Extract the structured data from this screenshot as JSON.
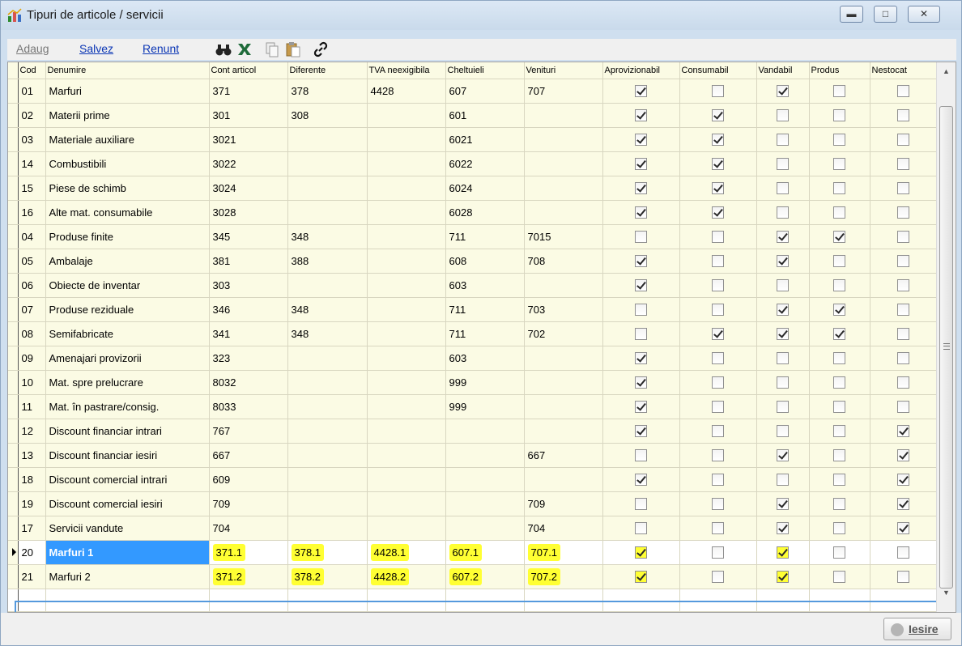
{
  "window": {
    "title": "Tipuri de articole / servicii",
    "icons": {
      "app": "chart-app-icon",
      "minimize": "minimize-icon",
      "restore": "restore-icon",
      "close": "close-icon"
    }
  },
  "toolbar": {
    "add_label": "Adaug",
    "save_label": "Salvez",
    "cancel_label": "Renunt",
    "icons": [
      "binoculars-icon",
      "excel-icon",
      "copy-icon",
      "paste-icon",
      "link-icon"
    ]
  },
  "grid": {
    "columns": [
      "Cod",
      "Denumire",
      "Cont articol",
      "Diferente",
      "TVA neexigibila",
      "Cheltuieli",
      "Venituri",
      "Aprovizionabil",
      "Consumabil",
      "Vandabil",
      "Produs",
      "Nestocat"
    ],
    "rows": [
      {
        "cod": "01",
        "denumire": "Marfuri",
        "cont": "371",
        "dif": "378",
        "tva": "4428",
        "chelt": "607",
        "ven": "707",
        "flags": [
          true,
          false,
          true,
          false,
          false
        ]
      },
      {
        "cod": "02",
        "denumire": "Materii prime",
        "cont": "301",
        "dif": "308",
        "tva": "",
        "chelt": "601",
        "ven": "",
        "flags": [
          true,
          true,
          false,
          false,
          false
        ]
      },
      {
        "cod": "03",
        "denumire": "Materiale auxiliare",
        "cont": "3021",
        "dif": "",
        "tva": "",
        "chelt": "6021",
        "ven": "",
        "flags": [
          true,
          true,
          false,
          false,
          false
        ]
      },
      {
        "cod": "14",
        "denumire": "Combustibili",
        "cont": "3022",
        "dif": "",
        "tva": "",
        "chelt": "6022",
        "ven": "",
        "flags": [
          true,
          true,
          false,
          false,
          false
        ]
      },
      {
        "cod": "15",
        "denumire": "Piese de schimb",
        "cont": "3024",
        "dif": "",
        "tva": "",
        "chelt": "6024",
        "ven": "",
        "flags": [
          true,
          true,
          false,
          false,
          false
        ]
      },
      {
        "cod": "16",
        "denumire": "Alte mat. consumabile",
        "cont": "3028",
        "dif": "",
        "tva": "",
        "chelt": "6028",
        "ven": "",
        "flags": [
          true,
          true,
          false,
          false,
          false
        ]
      },
      {
        "cod": "04",
        "denumire": "Produse finite",
        "cont": "345",
        "dif": "348",
        "tva": "",
        "chelt": "711",
        "ven": "7015",
        "flags": [
          false,
          false,
          true,
          true,
          false
        ]
      },
      {
        "cod": "05",
        "denumire": "Ambalaje",
        "cont": "381",
        "dif": "388",
        "tva": "",
        "chelt": "608",
        "ven": "708",
        "flags": [
          true,
          false,
          true,
          false,
          false
        ]
      },
      {
        "cod": "06",
        "denumire": "Obiecte de inventar",
        "cont": "303",
        "dif": "",
        "tva": "",
        "chelt": "603",
        "ven": "",
        "flags": [
          true,
          false,
          false,
          false,
          false
        ]
      },
      {
        "cod": "07",
        "denumire": "Produse reziduale",
        "cont": "346",
        "dif": "348",
        "tva": "",
        "chelt": "711",
        "ven": "703",
        "flags": [
          false,
          false,
          true,
          true,
          false
        ]
      },
      {
        "cod": "08",
        "denumire": "Semifabricate",
        "cont": "341",
        "dif": "348",
        "tva": "",
        "chelt": "711",
        "ven": "702",
        "flags": [
          false,
          true,
          true,
          true,
          false
        ]
      },
      {
        "cod": "09",
        "denumire": "Amenajari provizorii",
        "cont": "323",
        "dif": "",
        "tva": "",
        "chelt": "603",
        "ven": "",
        "flags": [
          true,
          false,
          false,
          false,
          false
        ]
      },
      {
        "cod": "10",
        "denumire": "Mat. spre prelucrare",
        "cont": "8032",
        "dif": "",
        "tva": "",
        "chelt": "999",
        "ven": "",
        "flags": [
          true,
          false,
          false,
          false,
          false
        ]
      },
      {
        "cod": "11",
        "denumire": "Mat. în pastrare/consig.",
        "cont": "8033",
        "dif": "",
        "tva": "",
        "chelt": "999",
        "ven": "",
        "flags": [
          true,
          false,
          false,
          false,
          false
        ]
      },
      {
        "cod": "12",
        "denumire": "Discount financiar intrari",
        "cont": "767",
        "dif": "",
        "tva": "",
        "chelt": "",
        "ven": "",
        "flags": [
          true,
          false,
          false,
          false,
          true
        ]
      },
      {
        "cod": "13",
        "denumire": "Discount financiar iesiri",
        "cont": "667",
        "dif": "",
        "tva": "",
        "chelt": "",
        "ven": "667",
        "flags": [
          false,
          false,
          true,
          false,
          true
        ]
      },
      {
        "cod": "18",
        "denumire": "Discount comercial intrari",
        "cont": "609",
        "dif": "",
        "tva": "",
        "chelt": "",
        "ven": "",
        "flags": [
          true,
          false,
          false,
          false,
          true
        ]
      },
      {
        "cod": "19",
        "denumire": "Discount comercial iesiri",
        "cont": "709",
        "dif": "",
        "tva": "",
        "chelt": "",
        "ven": "709",
        "flags": [
          false,
          false,
          true,
          false,
          true
        ]
      },
      {
        "cod": "17",
        "denumire": "Servicii vandute",
        "cont": "704",
        "dif": "",
        "tva": "",
        "chelt": "",
        "ven": "704",
        "flags": [
          false,
          false,
          true,
          false,
          true
        ]
      },
      {
        "cod": "20",
        "denumire": "Marfuri 1",
        "cont": "371.1",
        "dif": "378.1",
        "tva": "4428.1",
        "chelt": "607.1",
        "ven": "707.1",
        "flags": [
          true,
          false,
          true,
          false,
          false
        ],
        "selected": true,
        "highlight": true
      },
      {
        "cod": "21",
        "denumire": "Marfuri 2",
        "cont": "371.2",
        "dif": "378.2",
        "tva": "4428.2",
        "chelt": "607.2",
        "ven": "707.2",
        "flags": [
          true,
          false,
          true,
          false,
          false
        ],
        "highlight": true
      }
    ],
    "highlight_color": "#ffff33",
    "selection_color": "#3399ff"
  },
  "footer": {
    "exit_label": "Iesire",
    "exit_icon": "exit-icon"
  }
}
